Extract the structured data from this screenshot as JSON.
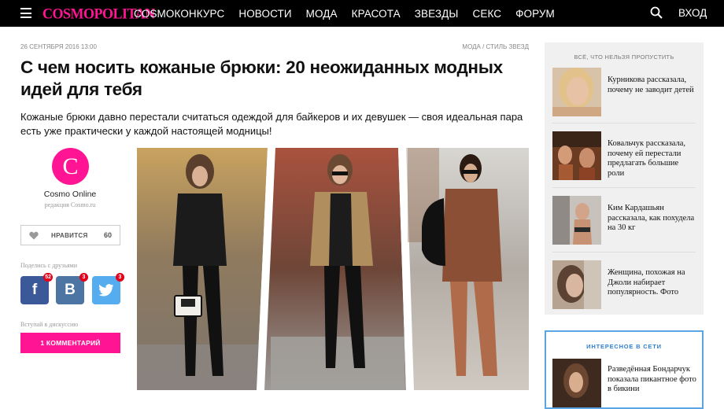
{
  "header": {
    "logo": "COSMOPOLITAN",
    "nav": [
      "COSMOКОНКУРС",
      "НОВОСТИ",
      "МОДА",
      "КРАСОТА",
      "ЗВЕЗДЫ",
      "СЕКС",
      "ФОРУМ"
    ],
    "login": "ВХОД"
  },
  "article": {
    "date": "26 СЕНТЯБРЯ 2016 13:00",
    "breadcrumb": "МОДА / СТИЛЬ ЗВЕЗД",
    "title": "С чем носить кожаные брюки: 20 неожиданных модных идей для тебя",
    "lead": "Кожаные брюки давно перестали считаться одеждой для байкеров и их девушек — своя идеальная пара есть уже практически у каждой настоящей модницы!"
  },
  "author": {
    "initial": "C",
    "name": "Cosmo Online",
    "role": "редакция Cosmo.ru"
  },
  "likes": {
    "label": "НРАВИТСЯ",
    "count": "60"
  },
  "share": {
    "label": "Поделись с друзьями",
    "facebook": {
      "glyph": "f",
      "count": "52"
    },
    "vk": {
      "glyph": "B",
      "count": "3"
    },
    "twitter": {
      "count": "3"
    }
  },
  "discussion": {
    "label": "Вступай в дискуссию",
    "button": "1 КОММЕНТАРИЙ"
  },
  "sidebar": {
    "title": "ВСЁ, ЧТО НЕЛЬЗЯ ПРОПУСТИТЬ",
    "items": [
      {
        "text": "Курникова рассказала, почему не заводит детей"
      },
      {
        "text": "Ковальчук рассказала, почему ей перестали предлагать большие роли"
      },
      {
        "text": "Ким Кардашьян рассказала, как похудела на 30 кг"
      },
      {
        "text": "Женщина, похожая на Джоли набирает популярность. Фото"
      }
    ],
    "web_title": "ИНТЕРЕСНОЕ В СЕТИ",
    "web_item": "Разведённая Бондарчук показала пикантное фото в бикини"
  },
  "colors": {
    "brand": "#ff1493",
    "facebook": "#3b5998",
    "vk": "#4c75a3",
    "twitter": "#55acee",
    "sidebar_border": "#5aa5e6"
  }
}
